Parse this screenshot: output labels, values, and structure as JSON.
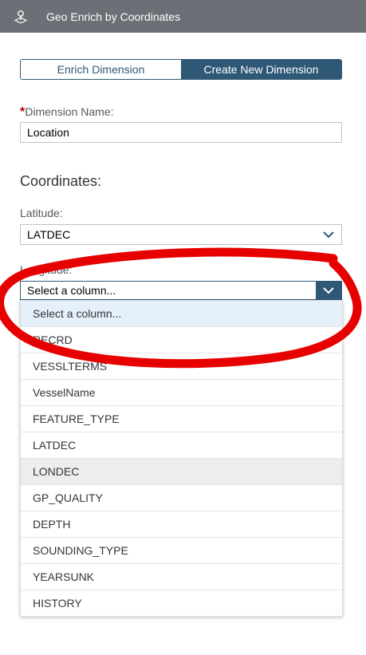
{
  "header": {
    "title": "Geo Enrich by Coordinates",
    "icon": "geo-pin-icon"
  },
  "segments": {
    "enrich": "Enrich Dimension",
    "create": "Create New Dimension"
  },
  "dimension": {
    "required_mark": "*",
    "label": "Dimension Name:",
    "value": "Location"
  },
  "coordinates": {
    "heading": "Coordinates:"
  },
  "latitude": {
    "label": "Latitude:",
    "value": "LATDEC"
  },
  "longitude": {
    "label": "Longitude:",
    "value": "Select a column..."
  },
  "options": [
    "Select a column...",
    "RECRD",
    "VESSLTERMS",
    "VesselName",
    "FEATURE_TYPE",
    "LATDEC",
    "LONDEC",
    "GP_QUALITY",
    "DEPTH",
    "SOUNDING_TYPE",
    "YEARSUNK",
    "HISTORY"
  ],
  "colors": {
    "header": "#6a7075",
    "accent": "#2f5877",
    "annotation": "#e60000"
  }
}
